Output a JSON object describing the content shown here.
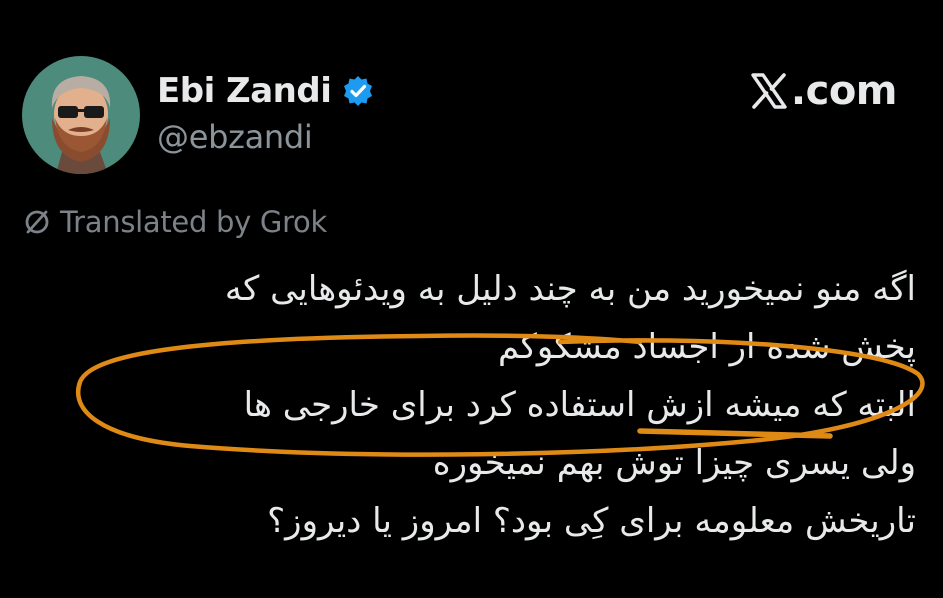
{
  "tweet": {
    "author": {
      "display_name": "Ebi Zandi",
      "handle": "@ebzandi",
      "verified": true,
      "verified_color": "#1d9bf0",
      "avatar_bg": "#4a8a7a"
    },
    "brand": {
      "text": ".com",
      "icon": "x-logo-icon"
    },
    "translated_label": "Translated by Grok",
    "translated_icon": "grok-slash-icon",
    "lines": [
      "اگه منو نمیخورید من به چند دلیل به ویدئوهایی که",
      "پخش شده از اجساد مشکوکم",
      "البته که میشه ازش استفاده کرد برای خارجی ها",
      "ولی یسری چیزا توش بهم نمیخوره",
      "تاریخش معلومه برای کِی بود؟ امروز یا دیروز؟"
    ]
  },
  "annotation": {
    "color": "#e08a16",
    "shape": "hand-drawn ellipse with underline"
  }
}
